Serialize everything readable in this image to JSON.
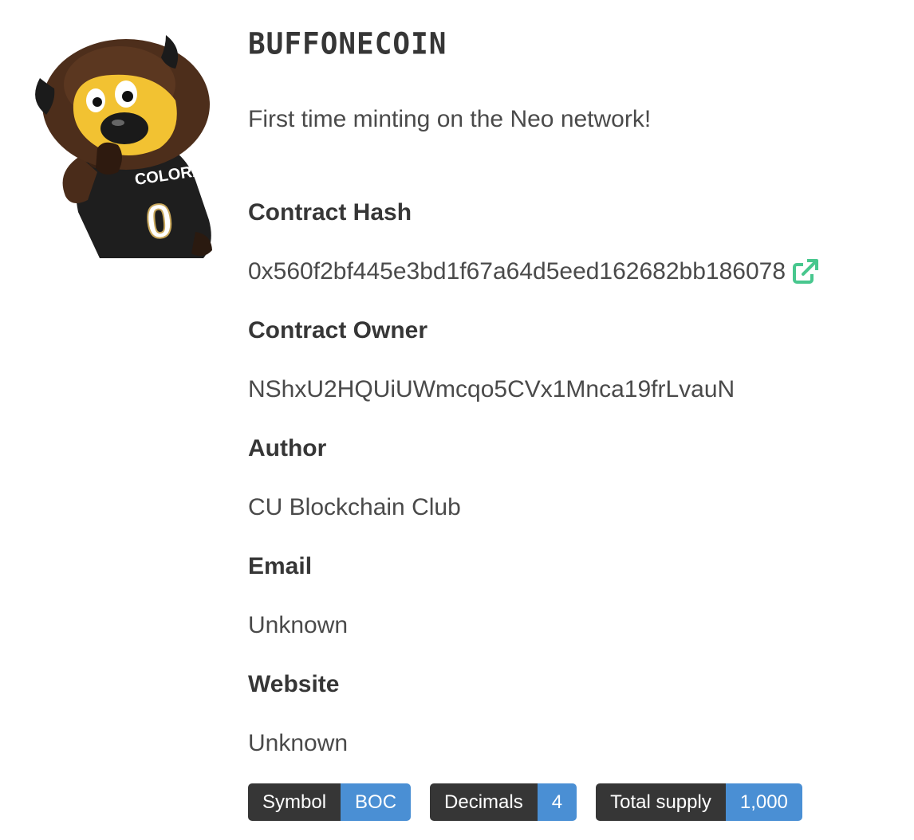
{
  "token": {
    "name": "BUFFONECOIN",
    "description": "First time minting on the Neo network!",
    "logo_icon": "buffalo-mascot-image"
  },
  "fields": {
    "contract_hash_label": "Contract Hash",
    "contract_hash_value": "0x560f2bf445e3bd1f67a64d5eed162682bb186078",
    "contract_owner_label": "Contract Owner",
    "contract_owner_value": "NShxU2HQUiUWmcqo5CVx1Mnca19frLvauN",
    "author_label": "Author",
    "author_value": "CU Blockchain Club",
    "email_label": "Email",
    "email_value": "Unknown",
    "website_label": "Website",
    "website_value": "Unknown"
  },
  "tags": [
    {
      "label": "Symbol",
      "value": "BOC"
    },
    {
      "label": "Decimals",
      "value": "4"
    },
    {
      "label": "Total supply",
      "value": "1,000"
    }
  ],
  "colors": {
    "tag_dark": "#363636",
    "tag_blue": "#4a8fd4",
    "link_icon": "#48c78e"
  },
  "icons": {
    "external_link": "external-link-icon"
  }
}
